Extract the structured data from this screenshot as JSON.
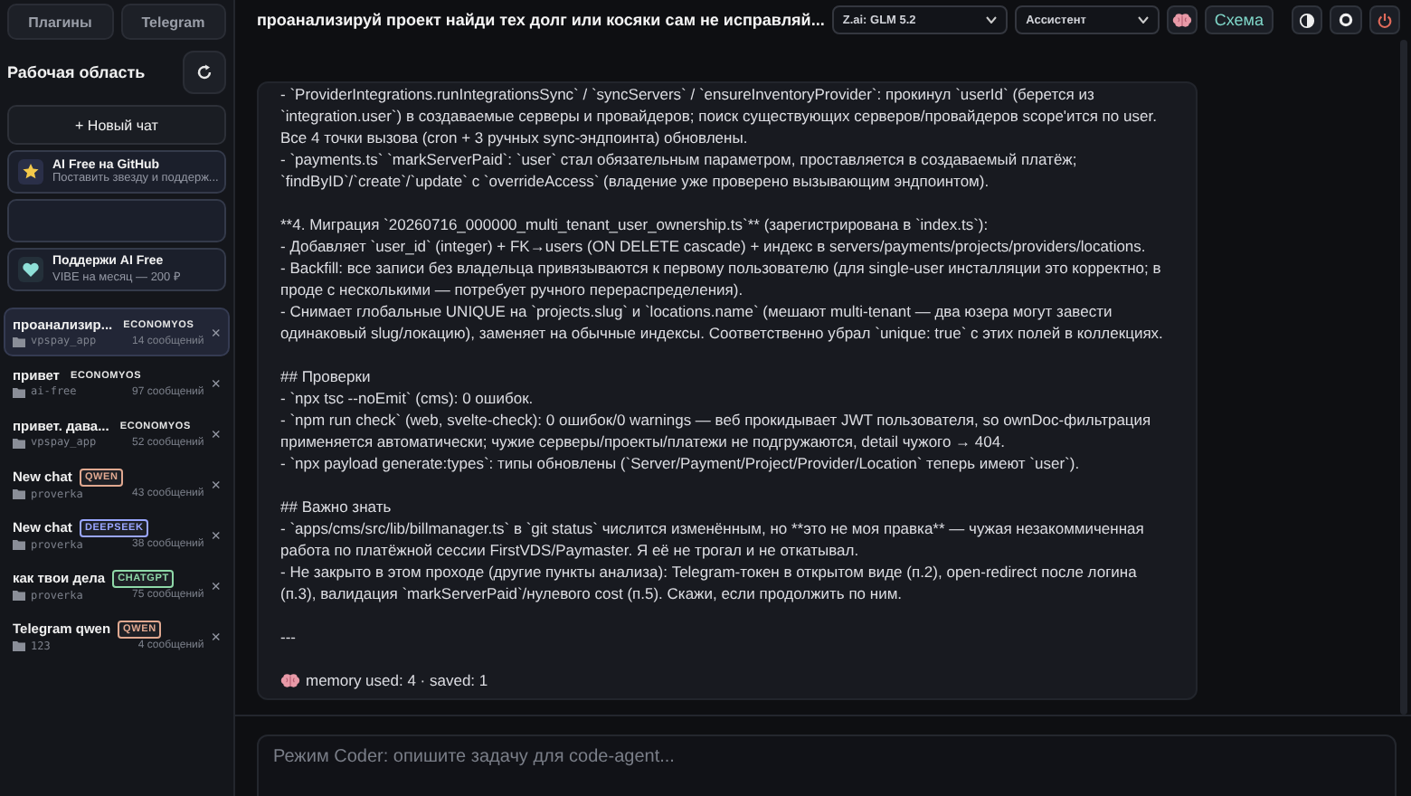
{
  "sidebar": {
    "top_buttons": [
      "Плагины",
      "Telegram"
    ],
    "workspace_title": "Рабочая область",
    "new_chat": "+ Новый чат",
    "promos": [
      {
        "kind": "star",
        "title": "AI Free на GitHub",
        "subtitle": "Поставить звезду и поддерж..."
      },
      {
        "kind": "empty"
      },
      {
        "kind": "heart",
        "title": "Поддержи AI Free",
        "subtitle": "VIBE на месяц — 200 ₽"
      }
    ],
    "chats": [
      {
        "title": "проанализир...",
        "badge": {
          "label": "ECONOMYOS"
        },
        "project": "vpspay_app",
        "count": "14 сообщений",
        "selected": true,
        "close": "×"
      },
      {
        "title": "привет",
        "badge": {
          "label": "ECONOMYOS"
        },
        "project": "ai-free",
        "count": "97 сообщений",
        "selected": false,
        "close": "×"
      },
      {
        "title": "привет. дава...",
        "badge": {
          "label": "ECONOMYOS"
        },
        "project": "vpspay_app",
        "count": "52 сообщений",
        "selected": false,
        "close": "×"
      },
      {
        "title": "New chat",
        "badge": {
          "label": "QWEN",
          "color": "#e0a890"
        },
        "project": "proverka",
        "count": "43 сообщений",
        "selected": false,
        "close": "×"
      },
      {
        "title": "New chat",
        "badge": {
          "label": "DEEPSEEK",
          "color": "#9aa6ff"
        },
        "project": "proverka",
        "count": "38 сообщений",
        "selected": false,
        "close": "×"
      },
      {
        "title": "как твои дела",
        "badge": {
          "label": "CHATGPT",
          "color": "#8fd8a8"
        },
        "project": "proverka",
        "count": "75 сообщений",
        "selected": false,
        "close": "×"
      },
      {
        "title": "Telegram qwen",
        "badge": {
          "label": "QWEN",
          "color": "#e0a890"
        },
        "project": "123",
        "count": "4 сообщений",
        "selected": false,
        "close": "×"
      }
    ]
  },
  "header": {
    "title": "проанализируй проект найди тех долг или косяки сам не исправляй...",
    "model": "Z.ai: GLM 5.2",
    "mode": "Ассистент",
    "schema_button": "Схема"
  },
  "message": {
    "blocks": [
      [
        "- `ProviderIntegrations.runIntegrationsSync` / `syncServers` / `ensureInventoryProvider`: прокинул `userId` (берется из `integration.user`) в создаваемые серверы и провайдеров; поиск существующих серверов/провайдеров scope'ится по user. Все 4 точки вызова (cron + 3 ручных sync-эндпоинта) обновлены.",
        "- `payments.ts` `markServerPaid`: `user` стал обязательным параметром, проставляется в создаваемый платёж; `findByID`/`create`/`update` с `overrideAccess` (владение уже проверено вызывающим эндпоинтом)."
      ],
      [
        "**4. Миграция `20260716_000000_multi_tenant_user_ownership.ts`** (зарегистрирована в `index.ts`):",
        "- Добавляет `user_id` (integer) + FK→users (ON DELETE cascade) + индекс в servers/payments/projects/providers/locations.",
        "- Backfill: все записи без владельца привязываются к первому пользователю (для single-user инсталляции это корректно; в проде с несколькими — потребует ручного перераспределения).",
        "- Снимает глобальные UNIQUE на `projects.slug` и `locations.name` (мешают multi-tenant — два юзера могут завести одинаковый slug/локацию), заменяет на обычные индексы. Соответственно убрал `unique: true` с этих полей в коллекциях."
      ],
      [
        "## Проверки",
        "- `npx tsc --noEmit` (cms): 0 ошибок.",
        "- `npm run check` (web, svelte-check): 0 ошибок/0 warnings — веб прокидывает JWT пользователя, so ownDoc-фильтрация применяется автоматически; чужие серверы/проекты/платежи не подгружаются, detail чужого → 404.",
        "- `npx payload generate:types`: типы обновлены (`Server/Payment/Project/Provider/Location` теперь имеют `user`)."
      ],
      [
        "## Важно знать",
        "- `apps/cms/src/lib/billmanager.ts` в `git status` числится изменённым, но **это не моя правка** — чужая незакоммиченная работа по платёжной сессии FirstVDS/Paymaster. Я её не трогал и не откатывал.",
        "- Не закрыто в этом проходе (другие пункты анализа): Telegram-токен в открытом виде (п.2), open-redirect после логина (п.3), валидация `markServerPaid`/нулевого cost (п.5). Скажи, если продолжить по ним."
      ],
      [
        "---"
      ]
    ],
    "footer": "memory used: 4 · saved: 1"
  },
  "composer": {
    "placeholder": "Режим Coder: опишите задачу для code-agent..."
  }
}
